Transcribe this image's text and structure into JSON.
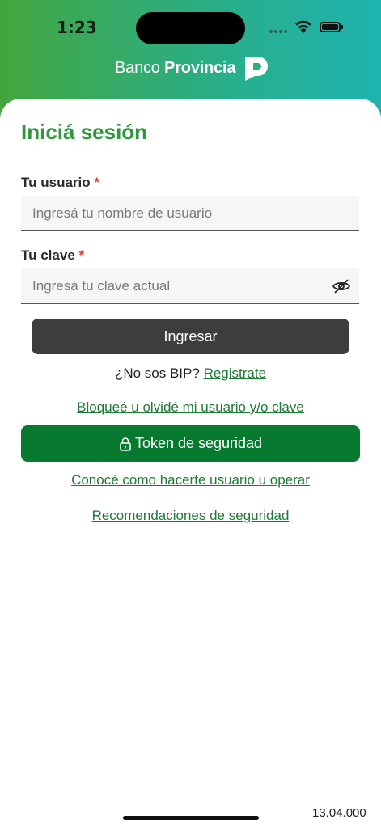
{
  "status_bar": {
    "time": "1:23"
  },
  "brand": {
    "name_light": "Banco ",
    "name_bold": "Provincia",
    "primary_color": "#2d9a3a",
    "token_color": "#087a2f"
  },
  "login": {
    "title": "Iniciá sesión",
    "user_label": "Tu usuario",
    "user_required": "*",
    "user_placeholder": "Ingresá tu nombre de usuario",
    "password_label": "Tu clave",
    "password_required": "*",
    "password_placeholder": "Ingresá tu clave actual",
    "login_button": "Ingresar",
    "not_bip_text": "¿No sos BIP? ",
    "register_link": "Registrate",
    "forgot_link": "Bloqueé u olvidé mi usuario y/o clave",
    "token_button": "Token de seguridad",
    "howto_link": "Conocé como hacerte usuario u operar",
    "security_link": "Recomendaciones de seguridad"
  },
  "footer": {
    "version": "13.04.000"
  },
  "icons": {
    "wifi": "wifi-icon",
    "battery": "battery-icon",
    "eye": "eye-off-icon",
    "lock": "lock-icon"
  }
}
